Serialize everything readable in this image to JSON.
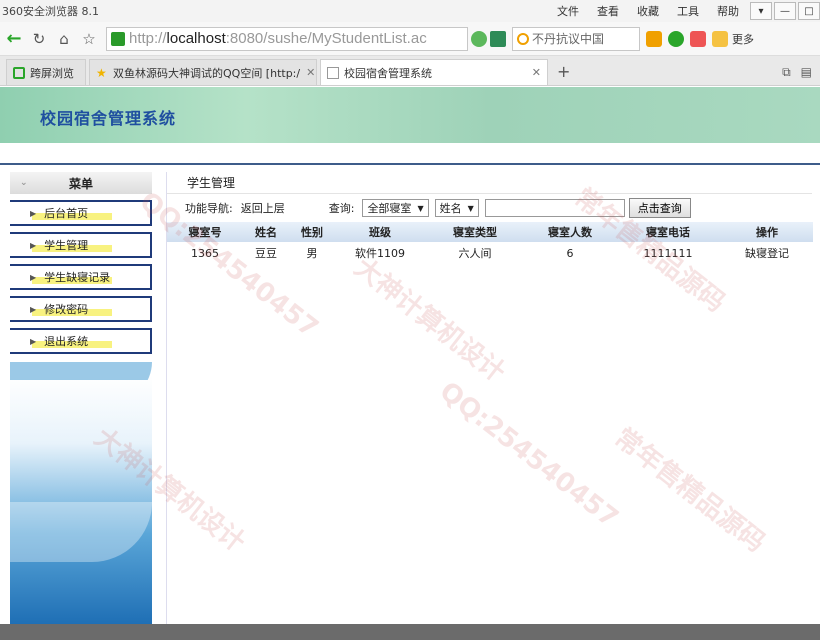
{
  "browser": {
    "app_title": "360安全浏览器 8.1",
    "menus": [
      "文件",
      "查看",
      "收藏",
      "工具",
      "帮助"
    ],
    "url_prefix": "http://",
    "url_host": "localhost",
    "url_rest": ":8080/sushe/MyStudentList.ac",
    "search_text": "不丹抗议中国",
    "more_label": "更多",
    "tabs": [
      {
        "label": "跨屏浏览"
      },
      {
        "label": "双鱼林源码大神调试的QQ空间 [http:/"
      },
      {
        "label": "校园宿舍管理系统"
      }
    ],
    "new_tab": "+"
  },
  "site": {
    "title": "校园宿舍管理系统"
  },
  "sidebar": {
    "header": "菜单",
    "items": [
      {
        "label": "后台首页"
      },
      {
        "label": "学生管理"
      },
      {
        "label": "学生缺寝记录"
      },
      {
        "label": "修改密码"
      },
      {
        "label": "退出系统"
      }
    ]
  },
  "main": {
    "section_title": "学生管理",
    "nav_label": "功能导航:",
    "back_link": "返回上层",
    "query_label": "查询:",
    "room_select": "全部寝室",
    "field_select": "姓名",
    "query_value": "",
    "query_button": "点击查询",
    "table": {
      "headers": [
        "寝室号",
        "姓名",
        "性别",
        "班级",
        "寝室类型",
        "寝室人数",
        "寝室电话",
        "操作"
      ],
      "rows": [
        [
          "1365",
          "豆豆",
          "男",
          "软件1109",
          "六人间",
          "6",
          "1111111",
          "缺寝登记"
        ]
      ]
    }
  },
  "watermarks": [
    "QQ:254540457",
    "大神计算机设计",
    "常年售精品源码"
  ]
}
